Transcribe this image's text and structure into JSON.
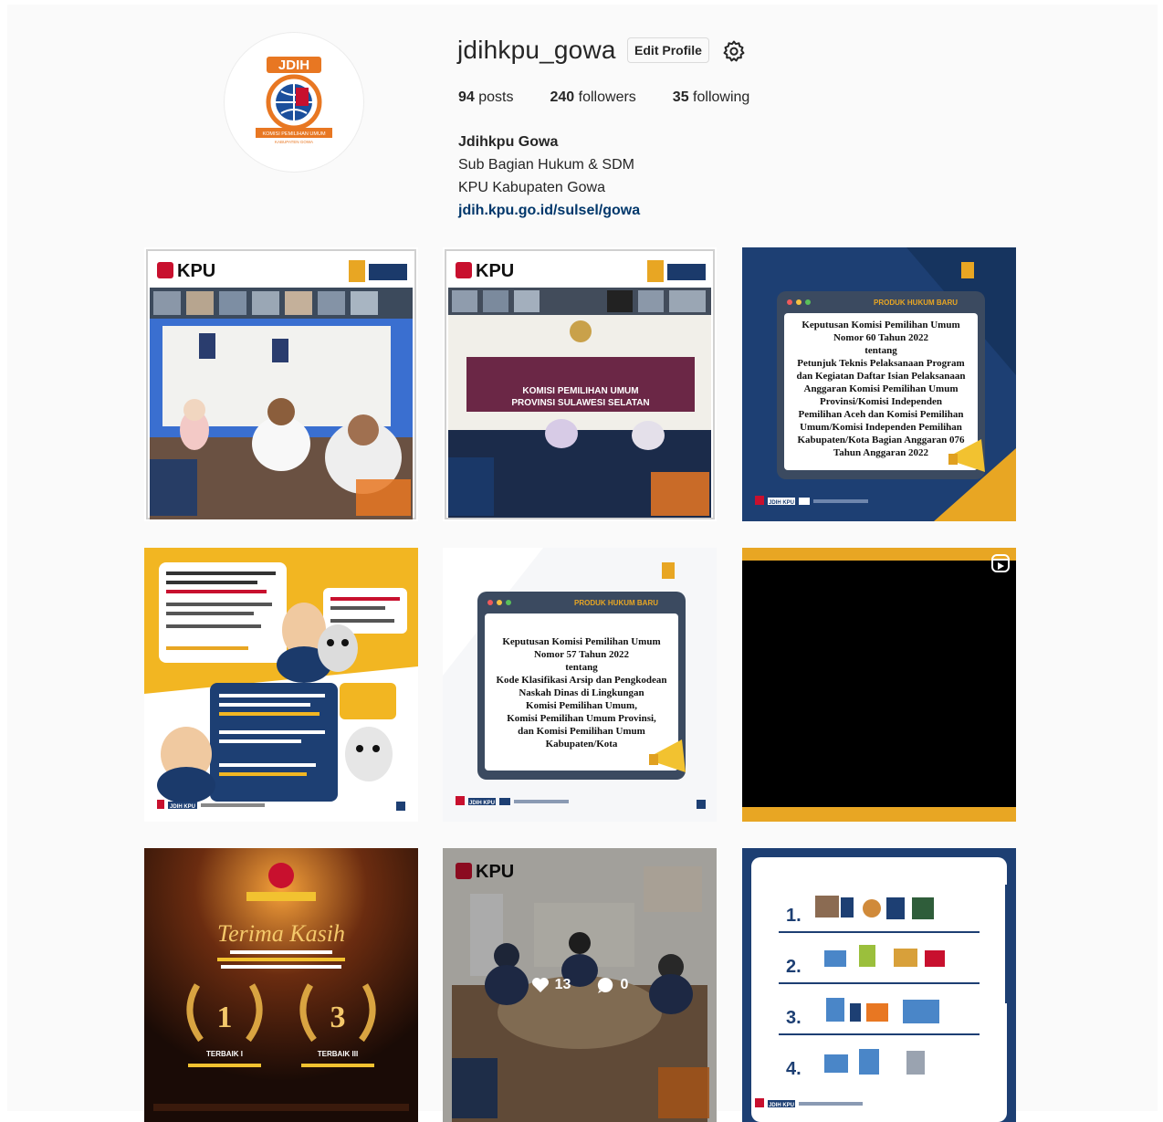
{
  "profile": {
    "username": "jdihkpu_gowa",
    "edit_profile_label": "Edit Profile",
    "stats": {
      "posts_count": "94",
      "posts_label": "posts",
      "followers_count": "240",
      "followers_label": "followers",
      "following_count": "35",
      "following_label": "following"
    },
    "bio": {
      "name": "Jdihkpu Gowa",
      "line1": "Sub Bagian Hukum & SDM",
      "line2": "KPU Kabupaten Gowa",
      "link": "jdih.kpu.go.id/sulsel/gowa"
    },
    "avatar": {
      "logo_text": "JDIH",
      "banner_text": "KOMISI PEMILIHAN UMUM",
      "sub_text": "KABUPATEN GOWA"
    }
  },
  "posts": [
    {
      "brand": "KPU"
    },
    {
      "brand": "KPU",
      "banner": "KOMISI PEMILIHAN UMUM\nPROVINSI SULAWESI SELATAN"
    },
    {
      "header": "PRODUK HUKUM BARU",
      "doc_lines": [
        "Keputusan Komisi Pemilihan Umum",
        "Nomor 60 Tahun 2022",
        "tentang",
        "Petunjuk Teknis Pelaksanaan Program",
        "dan Kegiatan Daftar Isian Pelaksanaan",
        "Anggaran Komisi Pemilihan Umum",
        "Provinsi/Komisi Independen",
        "Pemilihan Aceh dan Komisi Pemilihan",
        "Umum/Komisi Independen Pemilihan",
        "Kabupaten/Kota Bagian Anggaran 076",
        "Tahun Anggaran 2022"
      ],
      "footer": "JDIH KPU"
    },
    {
      "footer": "JDIH KPU"
    },
    {
      "header": "PRODUK HUKUM BARU",
      "doc_lines": [
        "Keputusan Komisi Pemilihan Umum",
        "Nomor 57 Tahun 2022",
        "tentang",
        "Kode Klasifikasi Arsip dan Pengkodean",
        "Naskah Dinas di Lingkungan",
        "Komisi Pemilihan Umum,",
        "Komisi Pemilihan Umum Provinsi,",
        "dan Komisi Pemilihan Umum",
        "Kabupaten/Kota"
      ],
      "footer": "JDIH KPU"
    },
    {
      "type": "reel"
    },
    {
      "script_title": "Terima Kasih",
      "rank1": "1",
      "rank1_label": "TERBAIK I",
      "rank3": "3",
      "rank3_label": "TERBAIK III"
    },
    {
      "brand": "KPU",
      "likes": "13",
      "comments": "0"
    },
    {
      "numbers": [
        "1.",
        "2.",
        "3.",
        "4."
      ],
      "footer": "JDIH KPU"
    }
  ],
  "colors": {
    "kpu_red": "#c8102e",
    "navy": "#1b3a6b",
    "gold": "#e8a623",
    "link_blue": "#00376b"
  }
}
